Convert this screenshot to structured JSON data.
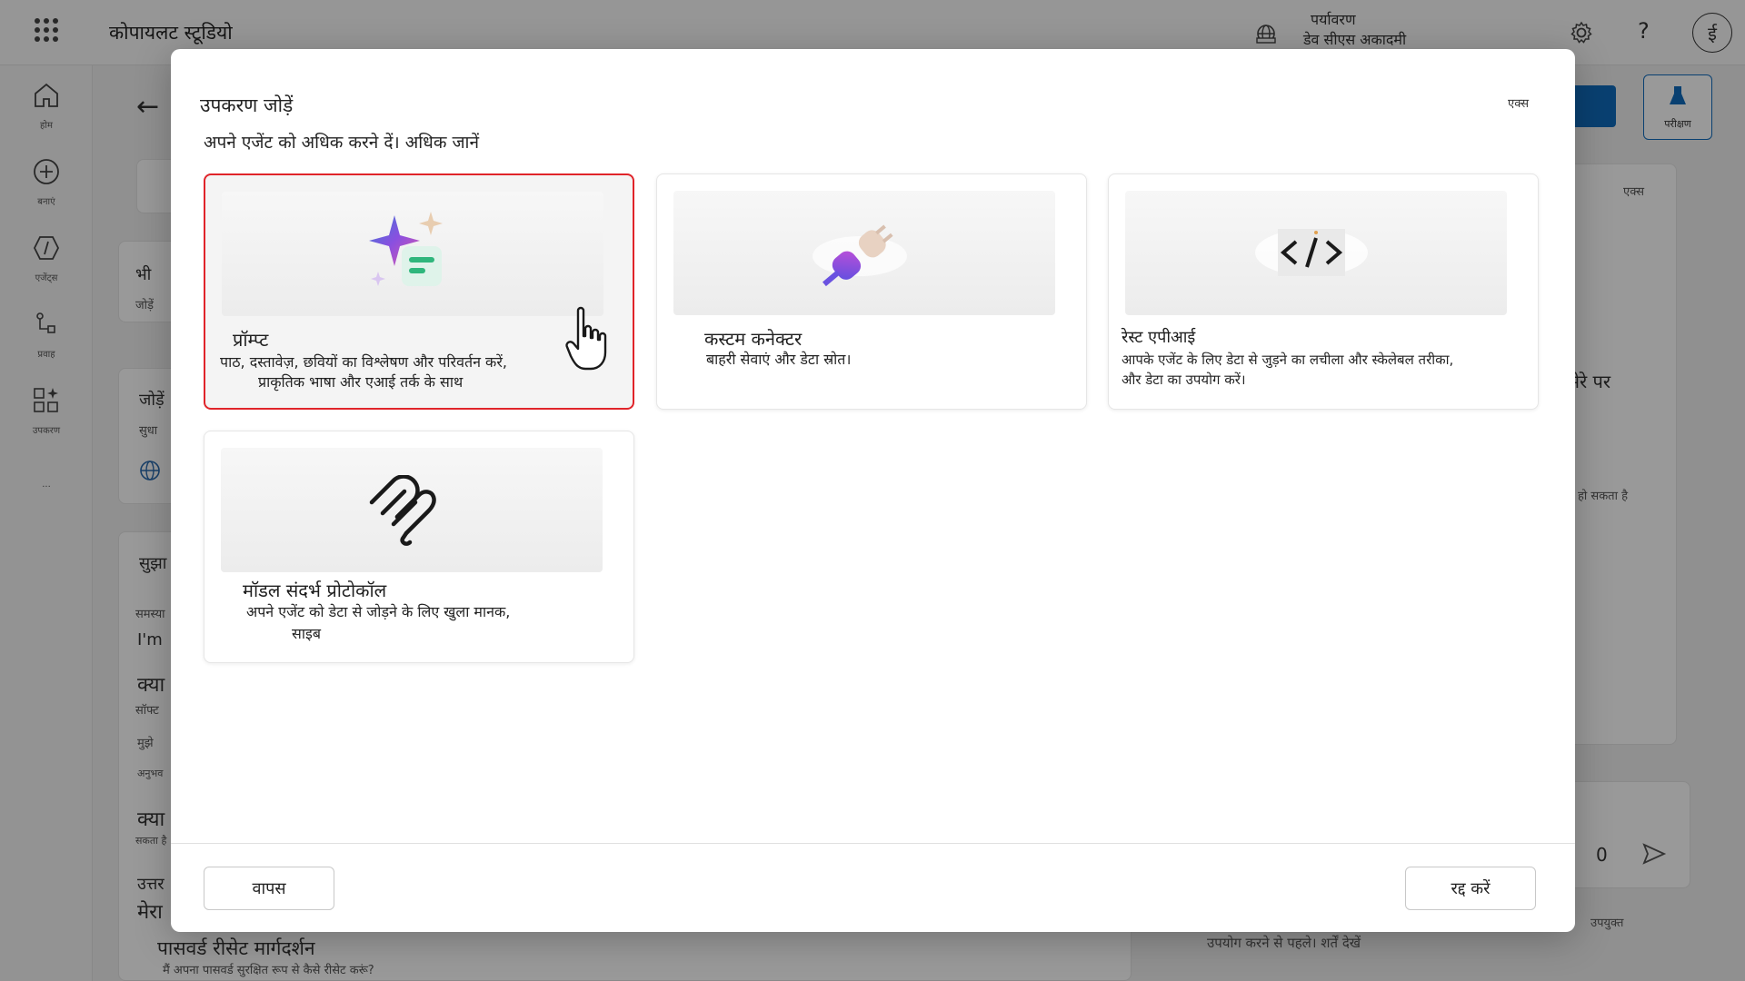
{
  "app": {
    "title": "कोपायलट स्टूडियो",
    "environment_label": "पर्यावरण",
    "environment_name": "डेव सीएस अकादमी",
    "help_symbol": "?",
    "avatar_initial": "ई"
  },
  "left_rail": [
    {
      "label": "होम",
      "icon": "home-icon"
    },
    {
      "label": "बनाएं",
      "icon": "plus-circle-icon"
    },
    {
      "label": "एजेंट्स",
      "icon": "agents-icon"
    },
    {
      "label": "प्रवाह",
      "icon": "flows-icon"
    },
    {
      "label": "उपकरण",
      "icon": "tools-icon"
    },
    {
      "label": "...",
      "icon": "more-icon"
    }
  ],
  "background": {
    "test_label": "परीक्षण",
    "panel_refresh_label": "एक्स",
    "panel_text_1": "मेरे पर",
    "panel_text_2": "हो सकता है",
    "footer_note": "उपयोग करने से पहले। शर्तें देखें",
    "attach_label": "उपयुक्त",
    "counter": "0",
    "card_texts": [
      "भी",
      "जोड़ें",
      "जोड़ें",
      "सुधा",
      "सुझा",
      "समस्या",
      "I'm",
      "क्या",
      "सॉफ्ट",
      "मुझे",
      "अनुभव",
      "क्या",
      "सकता है",
      "उत्तर",
      "मेरा"
    ],
    "suggestion_title": "पासवर्ड रीसेट मार्गदर्शन",
    "suggestion_text": "मैं अपना पासवर्ड सुरक्षित रूप से कैसे रीसेट करूं?"
  },
  "dialog": {
    "title": "उपकरण जोड़ें",
    "close_label": "एक्स",
    "subtitle": "अपने एजेंट को अधिक करने दें। अधिक जानें",
    "tools": [
      {
        "name": "प्रॉम्प्ट",
        "description_line1": "पाठ, दस्तावेज़, छवियों का विश्लेषण और परिवर्तन करें,",
        "description_line2": "प्राकृतिक भाषा और एआई तर्क के साथ",
        "icon": "prompt-sparkle-icon",
        "selected": true
      },
      {
        "name": "कस्टम कनेक्टर",
        "description_line1": "बाहरी सेवाएं और डेटा स्रोत।",
        "icon": "plug-connector-icon",
        "selected": false
      },
      {
        "name": "रेस्ट एपीआई",
        "description_line1": "आपके एजेंट के लिए डेटा से जुड़ने का लचीला और स्केलेबल तरीका,",
        "description_line2": "और डेटा का उपयोग करें।",
        "icon": "code-brackets-icon",
        "selected": false
      },
      {
        "name": "मॉडल संदर्भ प्रोटोकॉल",
        "description_line1": "अपने एजेंट को डेटा से जोड़ने के लिए खुला मानक,",
        "description_line2": "साइब",
        "icon": "mcp-icon",
        "selected": false
      }
    ],
    "back_label": "वापस",
    "cancel_label": "रद्द करें"
  },
  "colors": {
    "selection_border": "#e0242a",
    "accent": "#0f6cbd"
  }
}
